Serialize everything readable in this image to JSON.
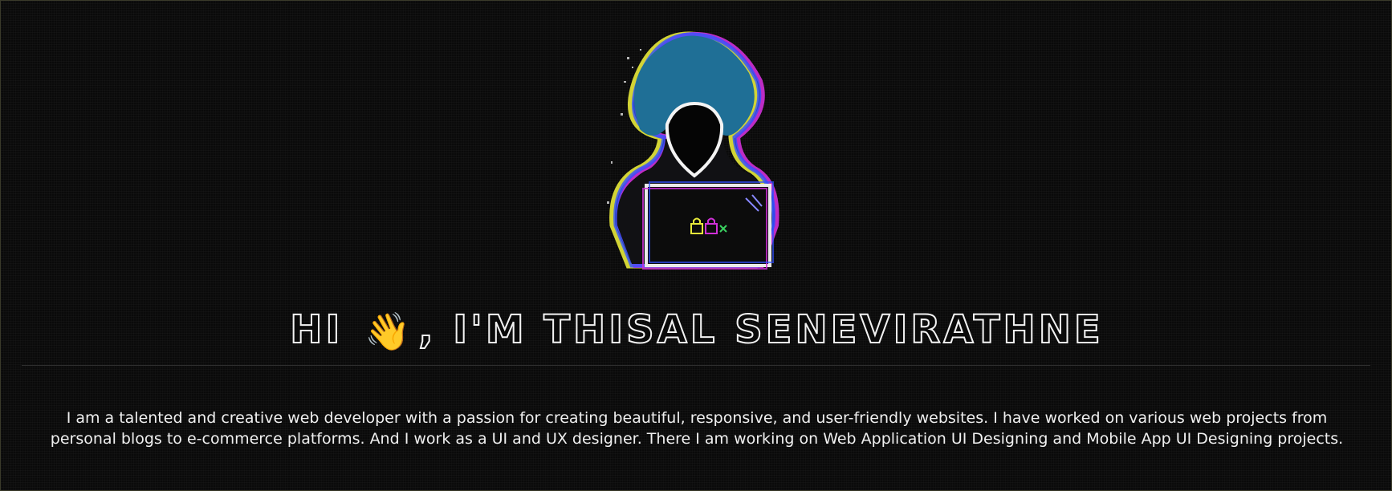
{
  "header": {
    "greeting": "HI",
    "wave_emoji": "👋",
    "name_part": ", I'M THISAL SENEVIRATHNE"
  },
  "hero": {
    "illustration": "glitch-hacker-icon"
  },
  "bio": {
    "text": "I am a talented and creative web developer with a passion for creating beautiful, responsive, and user-friendly websites. I have worked on various web projects from personal blogs to e-commerce platforms. And I work as a UI and UX designer. There I am working on Web Application UI Designing and Mobile App UI Designing projects."
  },
  "colors": {
    "background": "#0a0a0a",
    "hood": "#1f6f96",
    "glitch_yellow": "#e8ea3a",
    "glitch_magenta": "#d030d8",
    "glitch_blue": "#3050ff"
  }
}
